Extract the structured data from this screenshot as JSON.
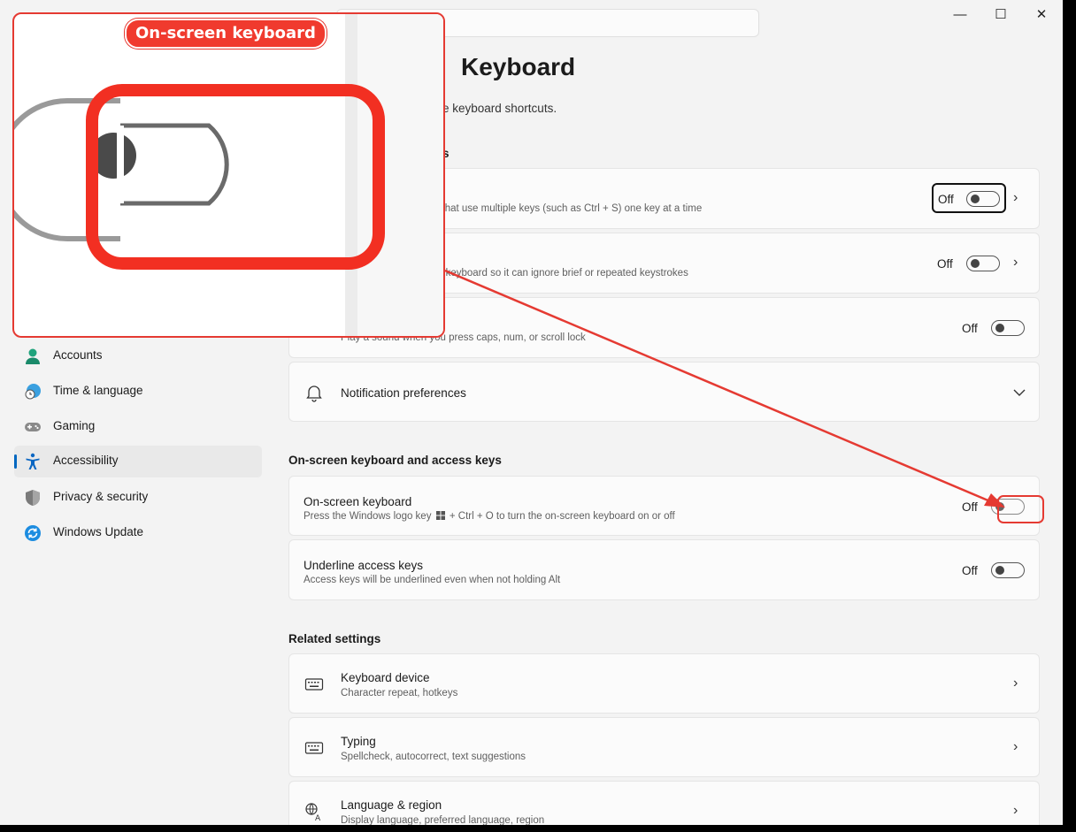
{
  "window": {
    "controls": {
      "minimize": "—",
      "maximize": "☐",
      "close": "✕"
    }
  },
  "header": {
    "breadcrumb_chevron": "›",
    "title": "Keyboard",
    "description_fragment": "e keyboard shortcuts.",
    "section_fragment": "s"
  },
  "sidebar": {
    "items": [
      {
        "label": "Accounts",
        "icon": "accounts-icon"
      },
      {
        "label": "Time & language",
        "icon": "time-language-icon"
      },
      {
        "label": "Gaming",
        "icon": "gaming-icon"
      },
      {
        "label": "Accessibility",
        "icon": "accessibility-icon",
        "active": true
      },
      {
        "label": "Privacy & security",
        "icon": "shield-icon"
      },
      {
        "label": "Windows Update",
        "icon": "windows-update-icon"
      }
    ]
  },
  "keys_cards": {
    "sticky": {
      "subtitle_fragment": "uts that use multiple keys (such as Ctrl + S) one key at a time",
      "state": "Off"
    },
    "filter": {
      "subtitle_fragment": "e keyboard so it can ignore brief or repeated keystrokes",
      "state": "Off"
    },
    "toggle_keys": {
      "subtitle_fragment": "Play a sound when you press caps, num, or scroll lock",
      "state": "Off"
    },
    "notification": {
      "title": "Notification preferences"
    }
  },
  "osk_section": {
    "heading": "On-screen keyboard and access keys",
    "onscreen_keyboard": {
      "title": "On-screen keyboard",
      "subtitle_before": "Press the Windows logo key",
      "subtitle_after": "+ Ctrl + O to turn the on-screen keyboard on or off",
      "state": "Off"
    },
    "underline_access_keys": {
      "title": "Underline access keys",
      "subtitle": "Access keys will be underlined even when not holding Alt",
      "state": "Off"
    }
  },
  "related": {
    "heading": "Related settings",
    "items": [
      {
        "title": "Keyboard device",
        "subtitle": "Character repeat, hotkeys",
        "icon": "keyboard-icon"
      },
      {
        "title": "Typing",
        "subtitle": "Spellcheck, autocorrect, text suggestions",
        "icon": "keyboard-icon"
      },
      {
        "title": "Language & region",
        "subtitle": "Display language, preferred language, region",
        "icon": "language-icon"
      }
    ]
  },
  "annotation": {
    "zoom_label": "On-screen keyboard",
    "accent_color": "#e53a32"
  },
  "colors": {
    "accent": "#0067c0",
    "annotation_red": "#e53a32"
  }
}
